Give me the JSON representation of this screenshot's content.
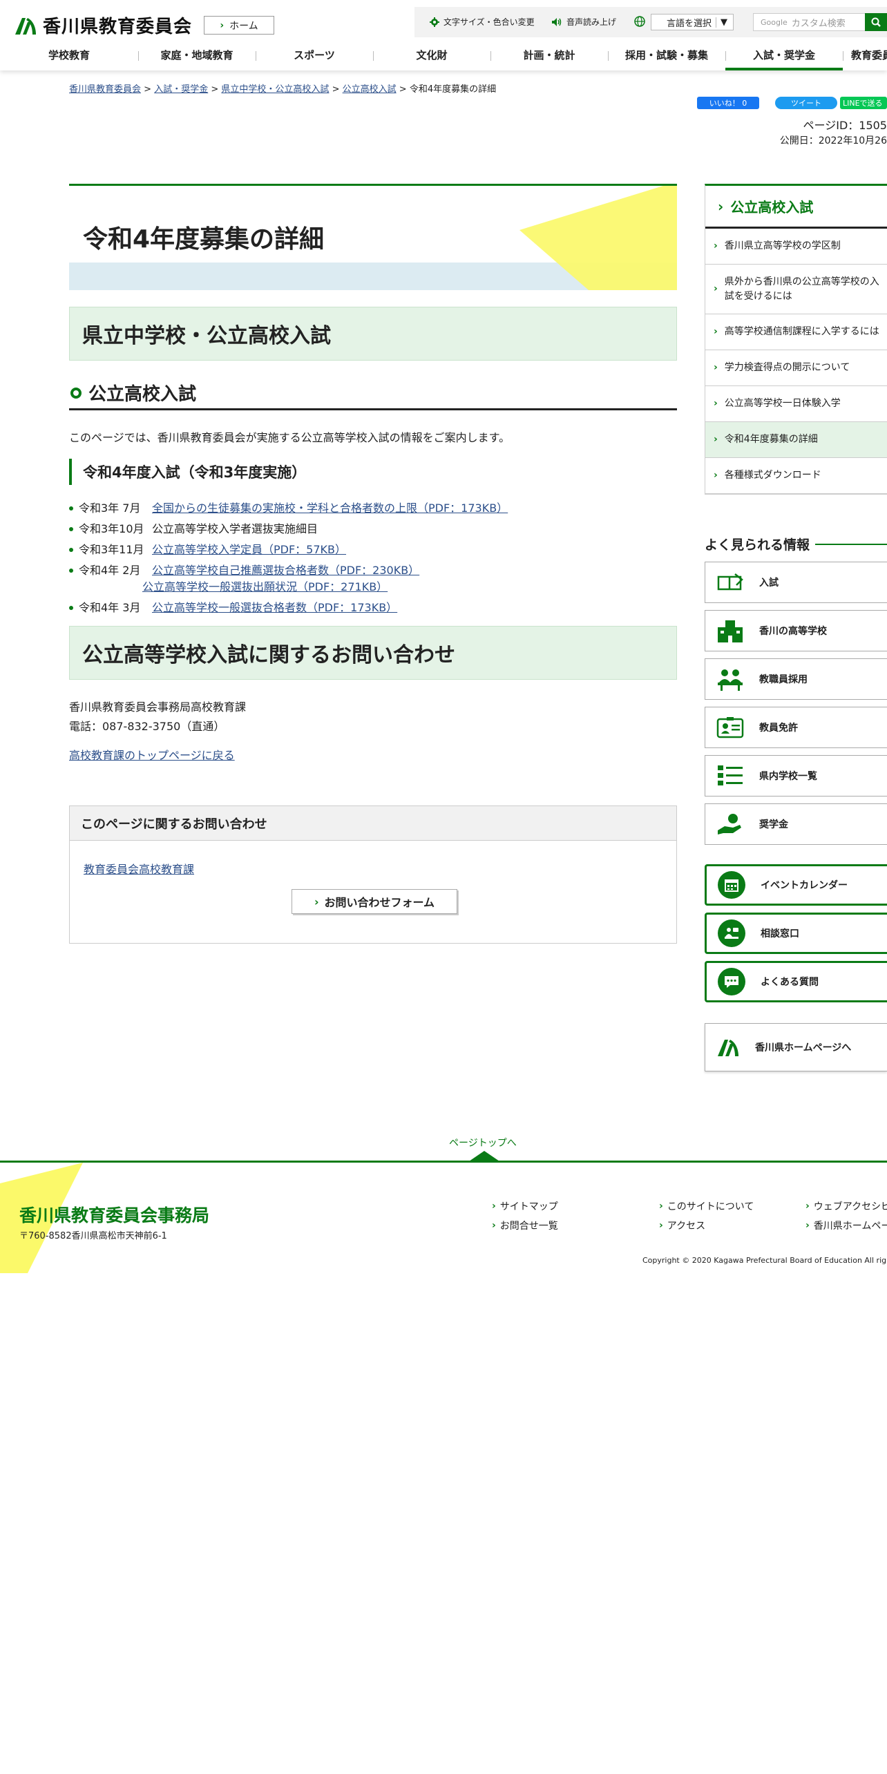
{
  "header": {
    "site_title": "香川県教育委員会",
    "home_label": "ホーム",
    "util_font_color": "文字サイズ・色合い変更",
    "util_voice": "音声読み上げ",
    "lang_select": "言語を選択",
    "search_placeholder": "カスタム検索",
    "search_brand": "Google"
  },
  "gnav": [
    "学校教育",
    "家庭・地域教育",
    "スポーツ",
    "文化財",
    "計画・統計",
    "採用・試験・募集",
    "入試・奨学金",
    "教育委員"
  ],
  "breadcrumb": {
    "items": [
      "香川県教育委員会",
      "入試・奨学金",
      "県立中学校・公立高校入試",
      "公立高校入試"
    ],
    "current": "令和4年度募集の詳細",
    "sep": ">"
  },
  "social": {
    "like": "いいね！ 0",
    "tweet": "ツイート",
    "line": "LINEで送る"
  },
  "meta": {
    "page_id": "ページID：1505",
    "published": "公開日：2022年10月26"
  },
  "main": {
    "title": "令和4年度募集の詳細",
    "section_title": "県立中学校・公立高校入試",
    "h3": "公立高校入試",
    "lead": "このページでは、香川県教育委員会が実施する公立高等学校入試の情報をご案内します。",
    "h4": "令和4年度入試（令和3年度実施）",
    "items": [
      {
        "date": "令和3年  7月",
        "lines": [
          "全国からの生徒募集の実施校・学科と合格者数の上限（PDF：173KB）"
        ],
        "link": true
      },
      {
        "date": "令和3年10月",
        "lines": [
          "公立高等学校入学者選抜実施細目"
        ],
        "link": false
      },
      {
        "date": "令和3年11月",
        "lines": [
          "公立高等学校入学定員（PDF：57KB）"
        ],
        "link": true
      },
      {
        "date": "令和4年  2月",
        "lines": [
          "公立高等学校自己推薦選抜合格者数（PDF：230KB）",
          "公立高等学校一般選抜出願状況（PDF：271KB）"
        ],
        "link": true
      },
      {
        "date": "令和4年  3月",
        "lines": [
          "公立高等学校一般選抜合格者数（PDF：173KB）"
        ],
        "link": true
      }
    ],
    "contact_title": "公立高等学校入試に関するお問い合わせ",
    "contact_org": "香川県教育委員会事務局高校教育課",
    "contact_tel": "電話：087-832-3750（直通）",
    "back_link": "高校教育課のトップページに戻る",
    "inquiry_title": "このページに関するお問い合わせ",
    "inquiry_link": "教育委員会高校教育課",
    "inquiry_button": "お問い合わせフォーム"
  },
  "sidebar": {
    "title": "公立高校入試",
    "items": [
      "香川県立高等学校の学区制",
      "県外から香川県の公立高等学校の入試を受けるには",
      "高等学校通信制課程に入学するには",
      "学力検査得点の開示について",
      "公立高等学校一日体験入学",
      "令和4年度募集の詳細",
      "各種様式ダウンロード"
    ],
    "current_index": 5,
    "popular_title": "よく見られる情報",
    "popular": [
      {
        "label": "入試",
        "icon": "book-pen-icon"
      },
      {
        "label": "香川の高等学校",
        "icon": "school-building-icon"
      },
      {
        "label": "教職員採用",
        "icon": "people-desk-icon"
      },
      {
        "label": "教員免許",
        "icon": "id-card-icon"
      },
      {
        "label": "県内学校一覧",
        "icon": "list-icon"
      },
      {
        "label": "奨学金",
        "icon": "hand-coin-icon"
      }
    ],
    "green_links": [
      {
        "label": "イベントカレンダー",
        "icon": "calendar-icon"
      },
      {
        "label": "相談窓口",
        "icon": "consultation-icon"
      },
      {
        "label": "よくある質問",
        "icon": "chat-bubble-icon"
      }
    ],
    "pref_link": "香川県ホームページへ"
  },
  "footer": {
    "pagetop": "ページトップへ",
    "org": "香川県教育委員会事務局",
    "address": "〒760-8582香川県高松市天神前6-1",
    "links": [
      "サイトマップ",
      "お問合せ一覧",
      "このサイトについて",
      "アクセス",
      "ウェブアクセシビ",
      "香川県ホームペー"
    ],
    "copyright": "Copyright © 2020 Kagawa Prefectural Board of Education All righ"
  },
  "colors": {
    "brand_green": "#0a7b16",
    "light_green": "#e4f3e6",
    "hero_yellow": "#fbf96a",
    "link_blue": "#2c4f8a"
  }
}
